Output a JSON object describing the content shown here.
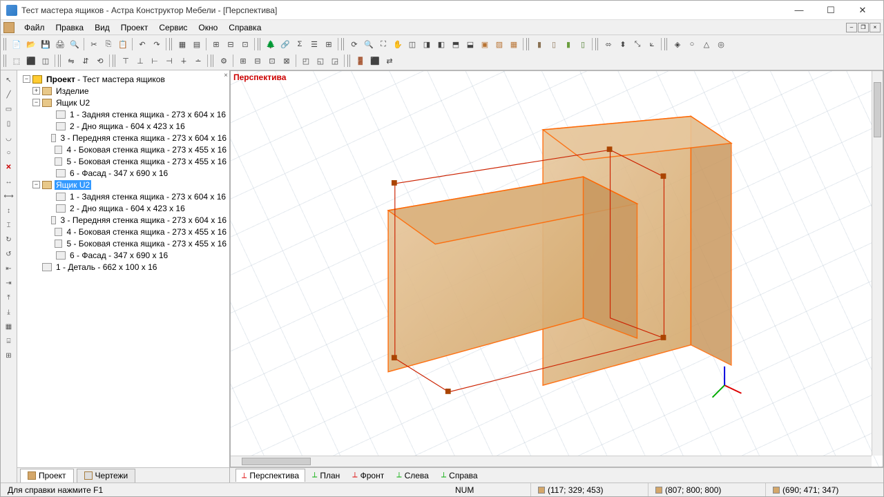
{
  "title": "Тест мастера ящиков - Астра Конструктор Мебели - [Перспектива]",
  "menu": {
    "file": "Файл",
    "edit": "Правка",
    "view": "Вид",
    "project": "Проект",
    "service": "Сервис",
    "window": "Окно",
    "help": "Справка"
  },
  "viewport": {
    "title": "Перспектива"
  },
  "tree": {
    "root": "Проект",
    "root_suffix": " - Тест мастера ящиков",
    "product": "Изделие",
    "drawer1": "Ящик U2",
    "drawer1_items": [
      "1 - Задняя стенка ящика - 273 x 604 x 16",
      "2 - Дно ящика - 604 x 423 x 16",
      "3 - Передняя стенка ящика - 273 x 604 x 16",
      "4 - Боковая стенка ящика - 273 x 455 x 16",
      "5 - Боковая стенка ящика - 273 x 455 x 16",
      "6 - Фасад - 347 x 690 x 16"
    ],
    "drawer2": "Ящик U2",
    "drawer2_items": [
      "1 - Задняя стенка ящика - 273 x 604 x 16",
      "2 - Дно ящика - 604 x 423 x 16",
      "3 - Передняя стенка ящика - 273 x 604 x 16",
      "4 - Боковая стенка ящика - 273 x 455 x 16",
      "5 - Боковая стенка ящика - 273 x 455 x 16",
      "6 - Фасад - 347 x 690 x 16"
    ],
    "detail": "1 - Деталь - 662 x 100 x 16",
    "tab_project": "Проект",
    "tab_drawings": "Чертежи"
  },
  "view_tabs": {
    "perspective": "Перспектива",
    "plan": "План",
    "front": "Фронт",
    "left": "Слева",
    "right": "Справа"
  },
  "status": {
    "help": "Для справки нажмите F1",
    "num": "NUM",
    "coord1": "(117; 329; 453)",
    "coord2": "(807; 800; 800)",
    "coord3": "(690; 471; 347)"
  }
}
